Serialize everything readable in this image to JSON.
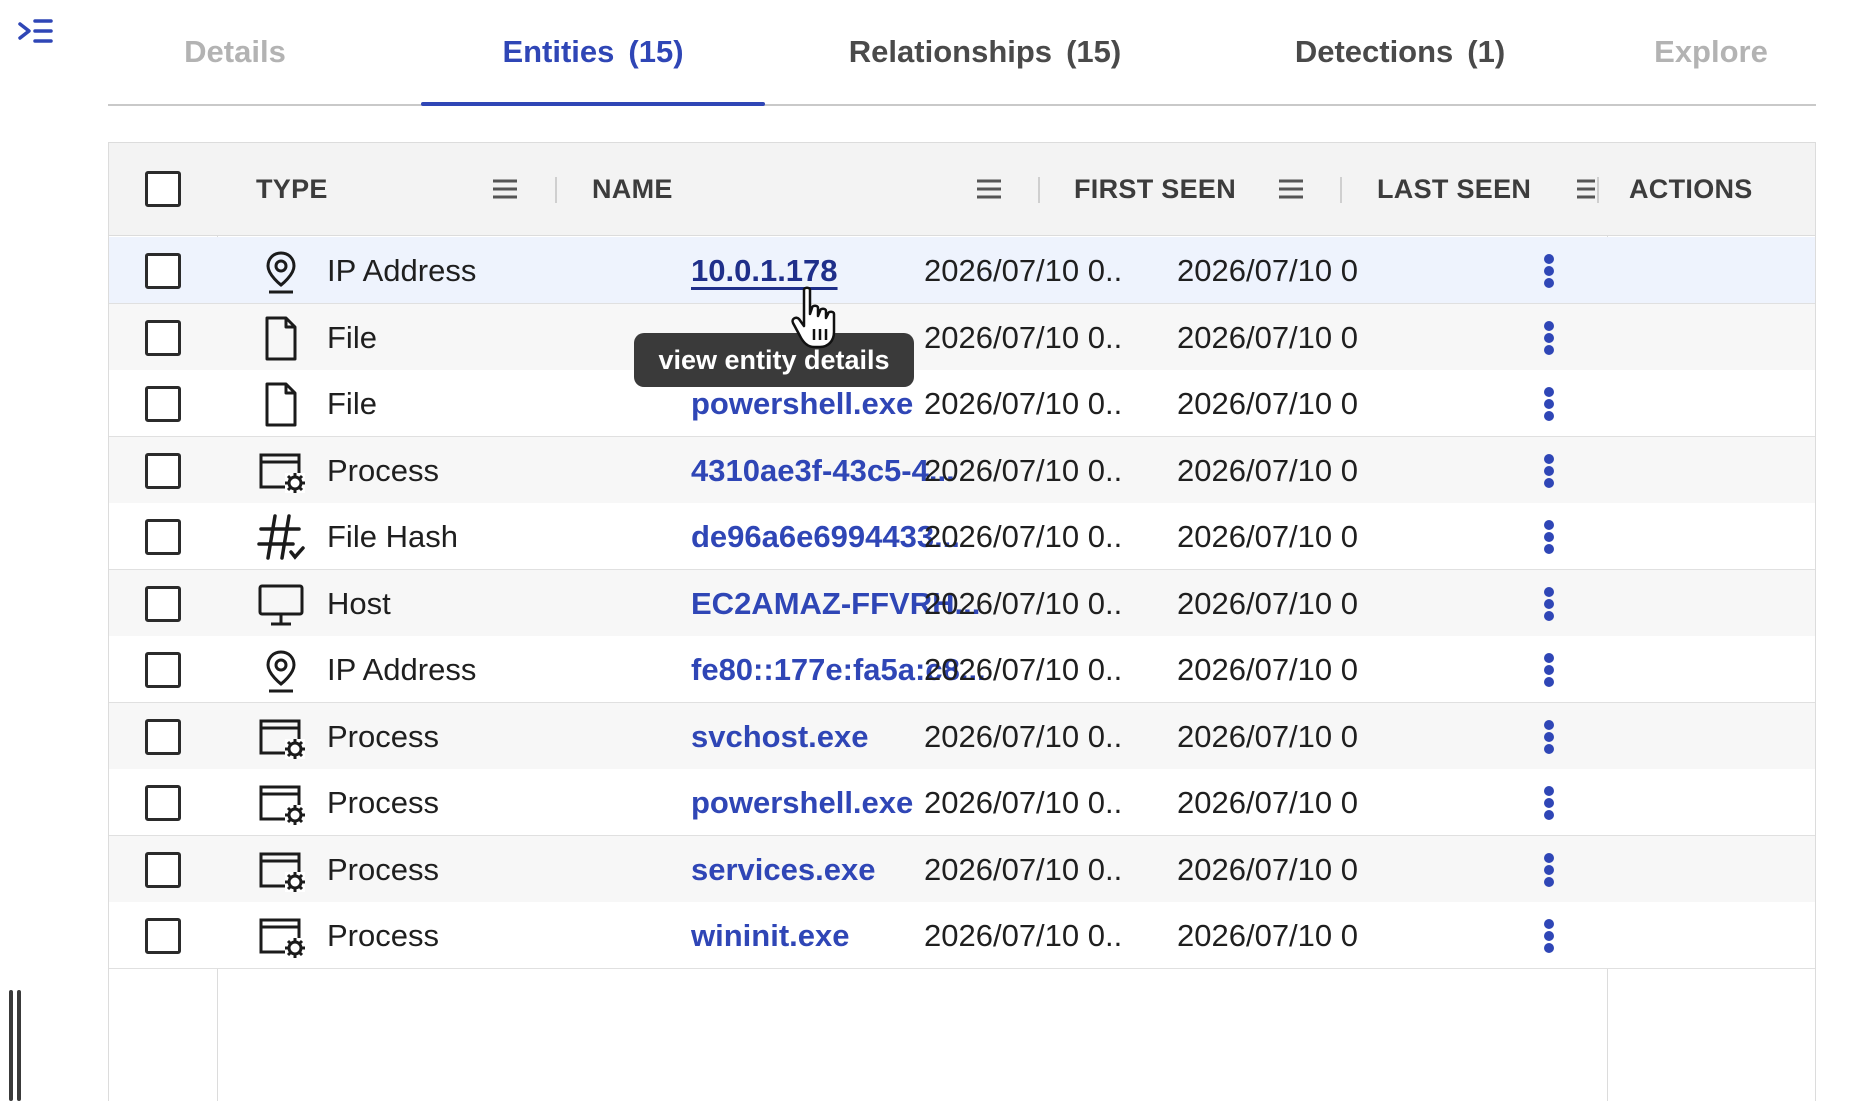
{
  "sidebar": {
    "collapse_icon": "collapse-menu-icon",
    "resize_icon": "drag-handle-icon"
  },
  "tabs": [
    {
      "label": "Details",
      "count": "",
      "state": "disabled"
    },
    {
      "label": "Entities",
      "count": "(15)",
      "state": "active"
    },
    {
      "label": "Relationships",
      "count": "(15)",
      "state": "normal"
    },
    {
      "label": "Detections",
      "count": "(1)",
      "state": "normal"
    },
    {
      "label": "Explore",
      "count": "",
      "state": "disabled"
    }
  ],
  "table": {
    "columns": {
      "type": "TYPE",
      "name": "NAME",
      "first_seen": "FIRST SEEN",
      "last_seen": "LAST SEEN",
      "actions": "ACTIONS"
    },
    "rows": [
      {
        "type": "IP Address",
        "icon": "location-pin-icon",
        "name": "10.0.1.178",
        "first_seen": "2026/07/10 0...",
        "last_seen": "2026/07/10 0..."
      },
      {
        "type": "File",
        "icon": "file-icon",
        "name": "",
        "first_seen": "2026/07/10 0...",
        "last_seen": "2026/07/10 0..."
      },
      {
        "type": "File",
        "icon": "file-icon",
        "name": "powershell.exe",
        "first_seen": "2026/07/10 0...",
        "last_seen": "2026/07/10 0..."
      },
      {
        "type": "Process",
        "icon": "process-window-gear-icon",
        "name": "4310ae3f-43c5-4...",
        "first_seen": "2026/07/10 0...",
        "last_seen": "2026/07/10 0..."
      },
      {
        "type": "File Hash",
        "icon": "hash-check-icon",
        "name": "de96a6e6994433...",
        "first_seen": "2026/07/10 0...",
        "last_seen": "2026/07/10 0..."
      },
      {
        "type": "Host",
        "icon": "monitor-icon",
        "name": "EC2AMAZ-FFVRH...",
        "first_seen": "2026/07/10 0...",
        "last_seen": "2026/07/10 0..."
      },
      {
        "type": "IP Address",
        "icon": "location-pin-icon",
        "name": "fe80::177e:fa5a:c8...",
        "first_seen": "2026/07/10 0...",
        "last_seen": "2026/07/10 0..."
      },
      {
        "type": "Process",
        "icon": "process-window-gear-icon",
        "name": "svchost.exe",
        "first_seen": "2026/07/10 0...",
        "last_seen": "2026/07/10 0..."
      },
      {
        "type": "Process",
        "icon": "process-window-gear-icon",
        "name": "powershell.exe",
        "first_seen": "2026/07/10 0...",
        "last_seen": "2026/07/10 0..."
      },
      {
        "type": "Process",
        "icon": "process-window-gear-icon",
        "name": "services.exe",
        "first_seen": "2026/07/10 0...",
        "last_seen": "2026/07/10 0..."
      },
      {
        "type": "Process",
        "icon": "process-window-gear-icon",
        "name": "wininit.exe",
        "first_seen": "2026/07/10 0...",
        "last_seen": "2026/07/10 0..."
      }
    ]
  },
  "tooltip": {
    "text": "view entity details"
  },
  "colors": {
    "accent": "#2f46b6",
    "hover_row": "#eef3fd",
    "tooltip_bg": "#3a3a3a"
  }
}
